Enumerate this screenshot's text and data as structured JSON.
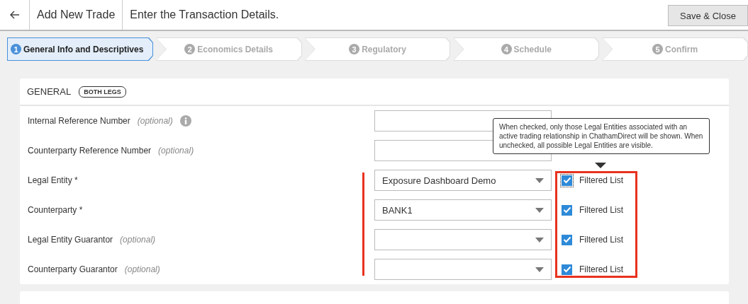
{
  "header": {
    "title": "Add New Trade",
    "subtitle": "Enter the Transaction Details.",
    "save_button": "Save & Close"
  },
  "steps": [
    {
      "number": "1",
      "label": "General Info and Descriptives",
      "selected": true
    },
    {
      "number": "2",
      "label": "Economics Details",
      "selected": false
    },
    {
      "number": "3",
      "label": "Regulatory",
      "selected": false
    },
    {
      "number": "4",
      "label": "Schedule",
      "selected": false
    },
    {
      "number": "5",
      "label": "Confirm",
      "selected": false
    }
  ],
  "general": {
    "title": "GENERAL",
    "badge": "BOTH LEGS",
    "fields": [
      {
        "label": "Internal Reference Number",
        "optional": "(optional)",
        "info": true,
        "kind": "text"
      },
      {
        "label": "Counterparty Reference Number",
        "optional": "(optional)",
        "info": false,
        "kind": "text"
      },
      {
        "label": "Legal Entity *",
        "info": false,
        "kind": "select",
        "value": "Exposure Dashboard Demo",
        "filter": {
          "label": "Filtered List",
          "checked": true,
          "focused": true
        }
      },
      {
        "label": "Counterparty *",
        "info": false,
        "kind": "select",
        "value": "BANK1",
        "filter": {
          "label": "Filtered List",
          "checked": true,
          "focused": false
        }
      },
      {
        "label": "Legal Entity Guarantor",
        "optional": "(optional)",
        "info": false,
        "kind": "select",
        "filter": {
          "label": "Filtered List",
          "checked": true,
          "focused": false
        }
      },
      {
        "label": "Counterparty Guarantor",
        "optional": "(optional)",
        "info": false,
        "kind": "select",
        "filter": {
          "label": "Filtered List",
          "checked": true,
          "focused": false
        }
      }
    ],
    "tooltip": "When checked, only those Legal Entities associated with an active trading relationship in ChathamDirect will be shown. When unchecked, all possible Legal Entities are visible."
  },
  "descriptives": {
    "kind": "panel"
  }
}
